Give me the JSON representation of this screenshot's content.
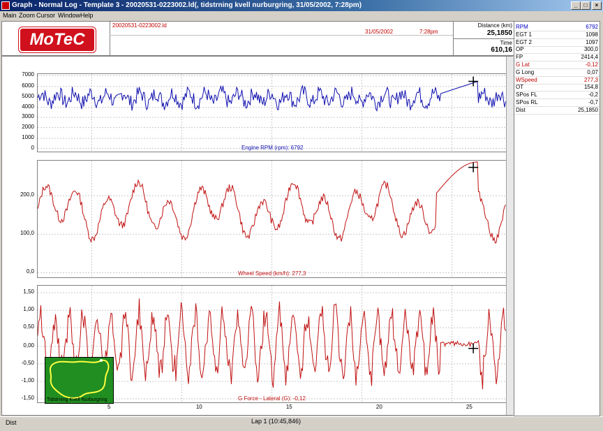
{
  "window": {
    "title": "Graph - Normal Log - Template 3 - 20020531-0223002.ld(, tidstrning kvell nurburgring, 31/05/2002,  7:28pm)",
    "buttons": [
      "_",
      "□",
      "×"
    ]
  },
  "menu": [
    "Main",
    "Zoom",
    "Cursor",
    "Window",
    "Help"
  ],
  "header": {
    "logo_text": "MoTeC",
    "file": "20020531-0223002.ld",
    "date": "31/05/2002",
    "time": "7:28pm",
    "distance_label": "Distance (km)",
    "distance_value": "25,1850",
    "time_label": "Time",
    "time_value": "610,16"
  },
  "channels": [
    {
      "name": "RPM",
      "value": "6792",
      "color": "#0000c0"
    },
    {
      "name": "EGT 1",
      "value": "1098",
      "color": "#000000"
    },
    {
      "name": "EGT 2",
      "value": "1097",
      "color": "#000000"
    },
    {
      "name": "OP",
      "value": "300,0",
      "color": "#000000"
    },
    {
      "name": "FP",
      "value": "2414,4",
      "color": "#000000"
    },
    {
      "name": "G Lat",
      "value": "-0,12",
      "color": "#c00000"
    },
    {
      "name": "G Long",
      "value": "0,07",
      "color": "#000000"
    },
    {
      "name": "WSpeed",
      "value": "277,3",
      "color": "#c00000"
    },
    {
      "name": "OT",
      "value": "154,8",
      "color": "#000000"
    },
    {
      "name": "SPos FL",
      "value": "-0,2",
      "color": "#000000"
    },
    {
      "name": "SPos RL",
      "value": "-0,7",
      "color": "#000000"
    },
    {
      "name": "Dist",
      "value": "25,1850",
      "color": "#000000"
    }
  ],
  "panels": [
    {
      "title": "Engine RPM (rpm): 6792",
      "color": "#1010b0",
      "y_ticks": [
        "7000",
        "6000",
        "5000",
        "4000",
        "3000",
        "2000",
        "1000",
        "0"
      ]
    },
    {
      "title": "Wheel Speed (km/h): 277,3",
      "color": "#c01010",
      "y_ticks": [
        "200,0",
        "100,0",
        "0,0"
      ]
    },
    {
      "title": "G Force - Lateral (G): -0,12",
      "color": "#c01010",
      "y_ticks": [
        "1,50",
        "1,00",
        "0,50",
        "0,00",
        "-0,50",
        "-1,00",
        "-1,50"
      ]
    }
  ],
  "x_axis": {
    "ticks": [
      "5",
      "10",
      "15",
      "20",
      "25"
    ],
    "label": "Lap 1 (10:45,846)",
    "unit": "Dist"
  },
  "track_map": {
    "name": "Tidstrning Kvell Nurburgring"
  },
  "chart_data": {
    "type": "line",
    "x_unit": "km",
    "xlim": [
      1,
      27
    ],
    "cursor_x": 25.185,
    "series": [
      {
        "name": "Engine RPM (rpm)",
        "ylim": [
          0,
          7500
        ],
        "cursor_value": 6792
      },
      {
        "name": "Wheel Speed (km/h)",
        "ylim": [
          0,
          280
        ],
        "cursor_value": 277.3
      },
      {
        "name": "G Force - Lateral (G)",
        "ylim": [
          -1.6,
          1.6
        ],
        "cursor_value": -0.12
      }
    ]
  }
}
